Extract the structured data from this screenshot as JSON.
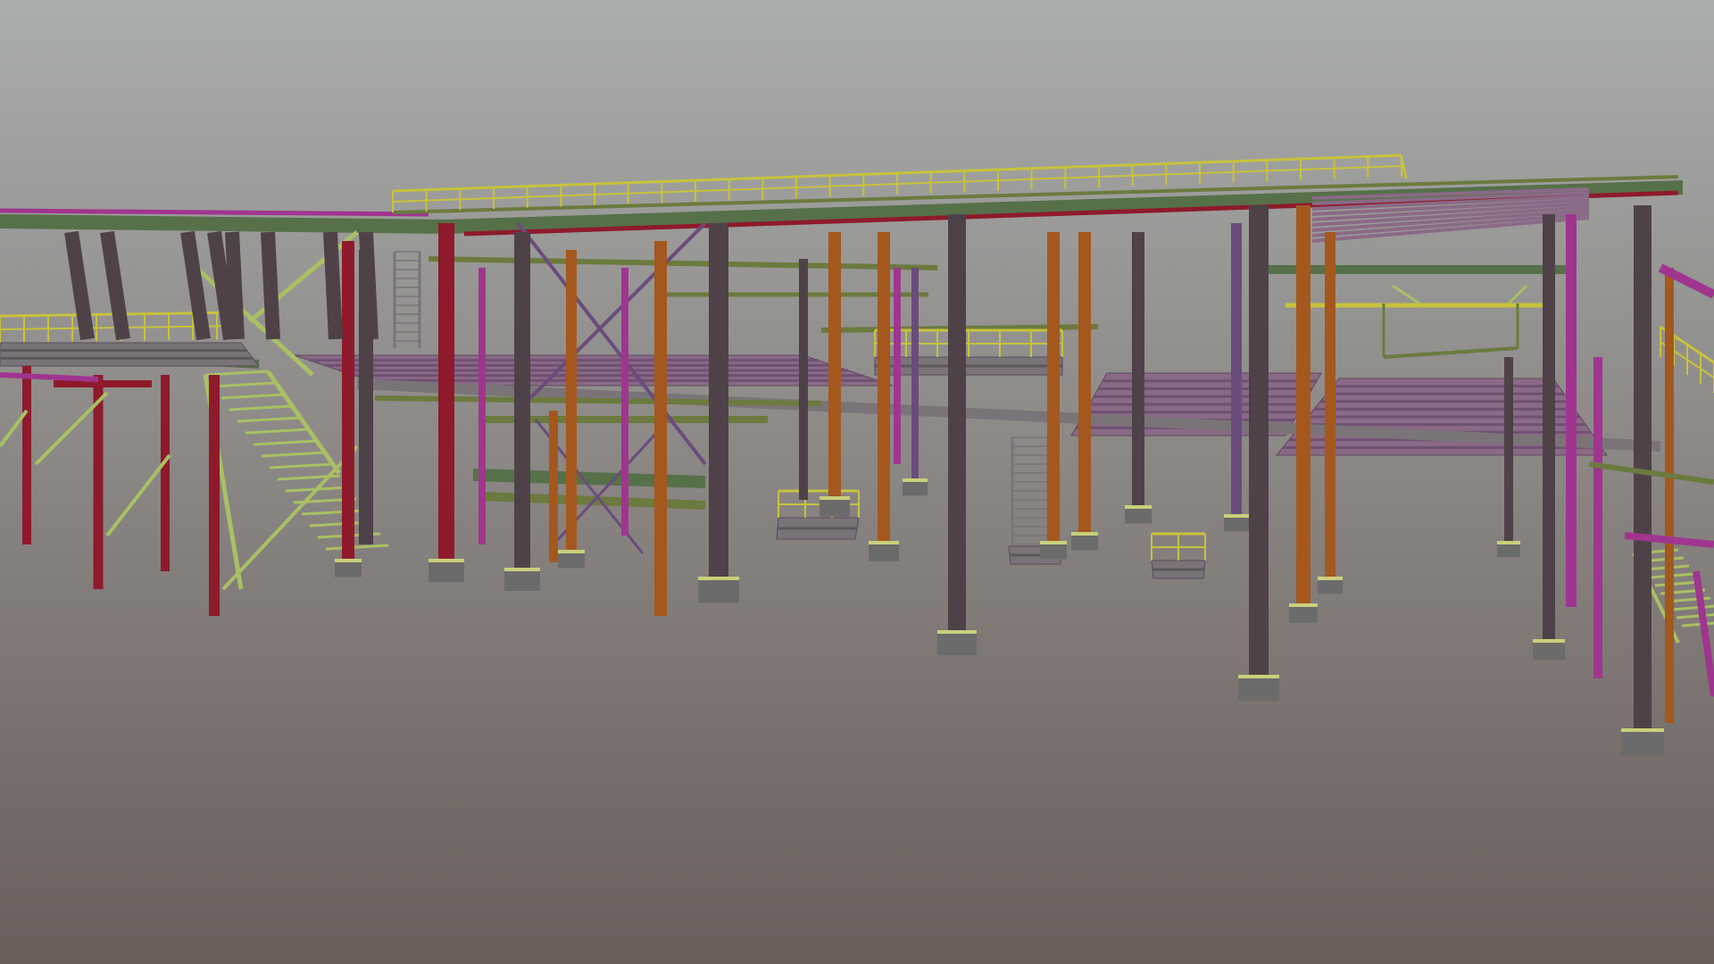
{
  "viewer": {
    "background_top": "#a9adab",
    "background_bottom": "#6a5e5b"
  },
  "palette": {
    "column_dark": "#4e4248",
    "column_red": "#8e1a2c",
    "beam_green": "#56704a",
    "beam_olive": "#6b7a3e",
    "member_orange": "#a4581e",
    "member_magenta": "#a0358f",
    "member_purple": "#6a4c7c",
    "rail_yellow": "#c7c23c",
    "rail_lime": "#a9c064",
    "deck_mauve": "#8a6a86",
    "deck_grey": "#7a7478",
    "footing": "#6b6b6b",
    "footing_top": "#c9d07a"
  },
  "scene": {
    "name": "steel-structure-3d-model"
  }
}
